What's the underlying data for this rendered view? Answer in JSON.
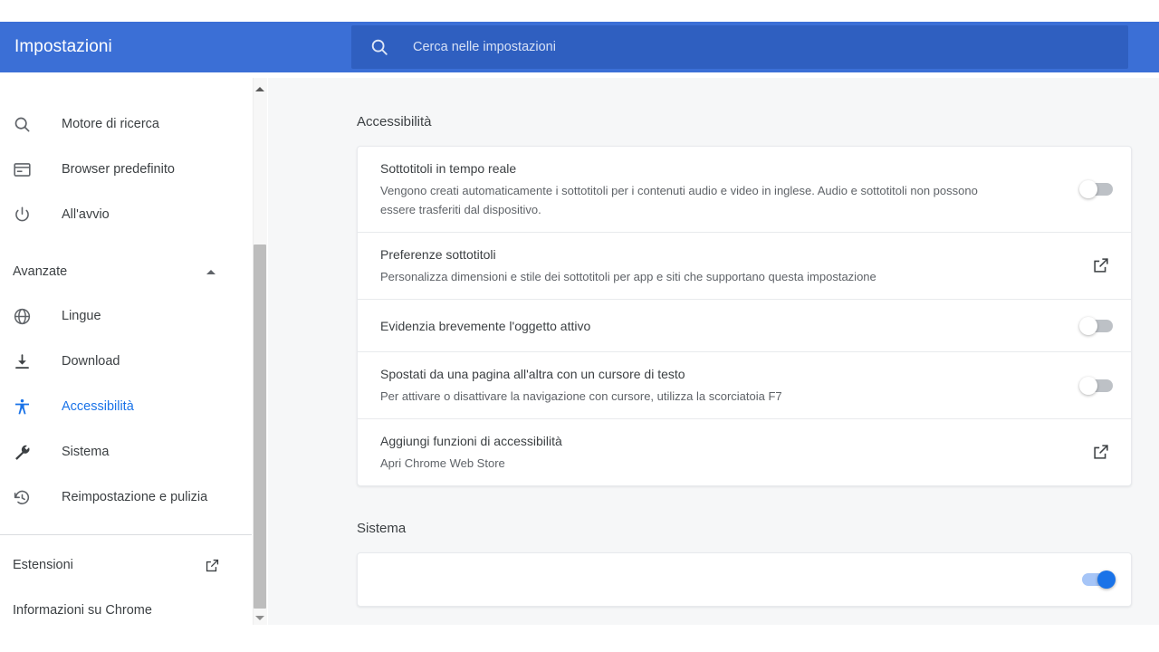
{
  "window": {
    "page_background": "#ffffff"
  },
  "header": {
    "title": "Impostazioni",
    "background": "#3b6fd6",
    "search": {
      "placeholder": "Cerca nelle impostazioni",
      "value": "",
      "icon": "search-icon",
      "background": "#2f5fc0"
    }
  },
  "sidebar": {
    "items": [
      {
        "label": "Motore di ricerca",
        "icon": "search-icon",
        "selected": false
      },
      {
        "label": "Browser predefinito",
        "icon": "browser-window-icon",
        "selected": false
      },
      {
        "label": "All'avvio",
        "icon": "power-icon",
        "selected": false
      }
    ],
    "section": {
      "label": "Avanzate",
      "expanded": true,
      "icon": "chevron-up-icon"
    },
    "advanced_items": [
      {
        "label": "Lingue",
        "icon": "globe-icon",
        "selected": false
      },
      {
        "label": "Download",
        "icon": "download-icon",
        "selected": false
      },
      {
        "label": "Accessibilità",
        "icon": "accessibility-person-icon",
        "selected": true
      },
      {
        "label": "Sistema",
        "icon": "wrench-icon",
        "selected": false
      },
      {
        "label": "Reimpostazione e pulizia",
        "icon": "history-restore-icon",
        "selected": false
      }
    ],
    "footer_items": [
      {
        "label": "Estensioni",
        "icon": "external-link-icon",
        "has_external": true
      },
      {
        "label": "Informazioni su Chrome",
        "icon": "",
        "has_external": false
      }
    ],
    "selected_color": "#1a73e8",
    "scrollbar": {
      "up_icon": "triangle-up-icon",
      "down_icon": "triangle-down-icon"
    }
  },
  "main": {
    "sections": [
      {
        "title": "Accessibilità",
        "rows": [
          {
            "title": "Sottotitoli in tempo reale",
            "sub": "Vengono creati automaticamente i sottotitoli per i contenuti audio e video in inglese. Audio e sottotitoli non possono essere trasferiti dal dispositivo.",
            "control": "toggle",
            "state": "off"
          },
          {
            "title": "Preferenze sottotitoli",
            "sub": "Personalizza dimensioni e stile dei sottotitoli per app e siti che supportano questa impostazione",
            "control": "external-link",
            "state": ""
          },
          {
            "title": "Evidenzia brevemente l'oggetto attivo",
            "sub": "",
            "control": "toggle",
            "state": "off"
          },
          {
            "title": "Spostati da una pagina all'altra con un cursore di testo",
            "sub": "Per attivare o disattivare la navigazione con cursore, utilizza la scorciatoia F7",
            "control": "toggle",
            "state": "off"
          },
          {
            "title": "Aggiungi funzioni di accessibilità",
            "sub": "Apri Chrome Web Store",
            "control": "external-link",
            "state": ""
          }
        ]
      },
      {
        "title": "Sistema",
        "rows": [
          {
            "title": "",
            "sub": "",
            "control": "toggle",
            "state": "on"
          }
        ]
      }
    ]
  }
}
